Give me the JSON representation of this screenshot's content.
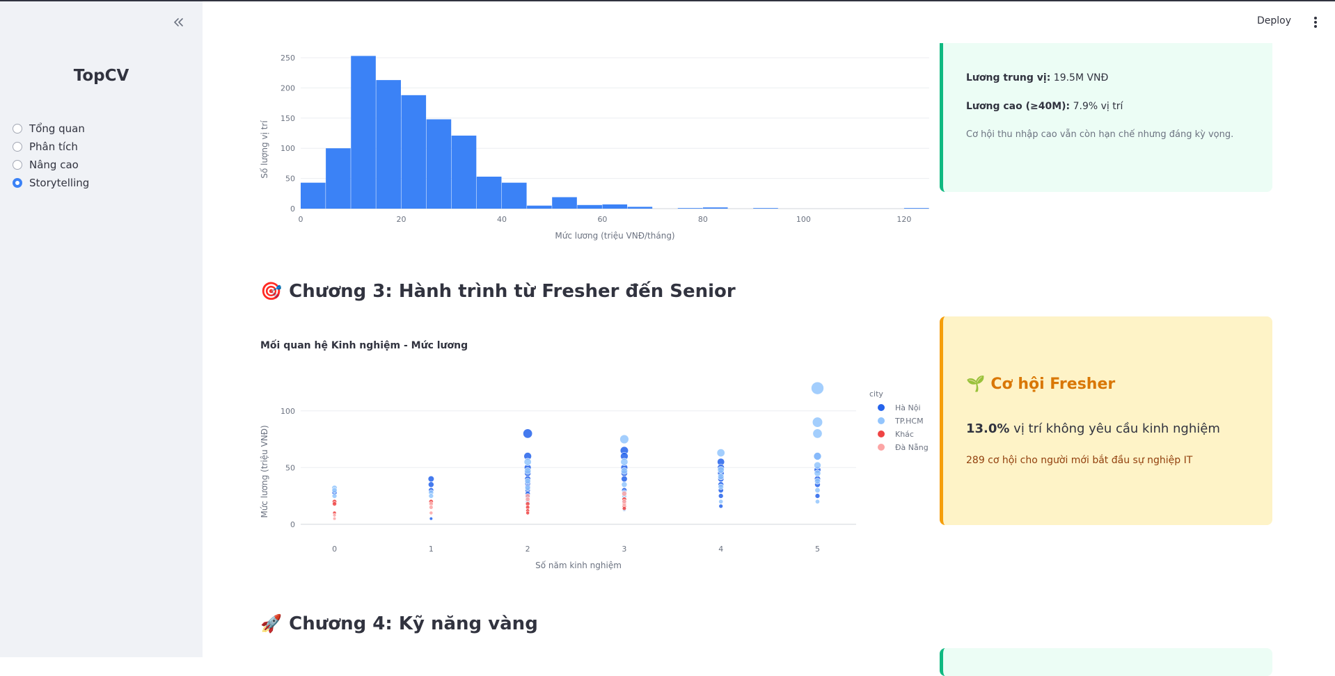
{
  "sidebar": {
    "brand": "TopCV",
    "nav": [
      {
        "label": "Tổng quan",
        "selected": false
      },
      {
        "label": "Phân tích",
        "selected": false
      },
      {
        "label": "Nâng cao",
        "selected": false
      },
      {
        "label": "Storytelling",
        "selected": true
      }
    ]
  },
  "header": {
    "deploy_label": "Deploy"
  },
  "histogram": {
    "chart_data": {
      "type": "bar",
      "xlabel": "Mức lương (triệu VNĐ/tháng)",
      "ylabel": "Số lượng vị trí",
      "xlim": [
        0,
        125
      ],
      "ylim": [
        0,
        265
      ],
      "x_ticks": [
        0,
        20,
        40,
        60,
        80,
        100,
        120
      ],
      "y_ticks": [
        0,
        50,
        100,
        150,
        200,
        250
      ],
      "bin_width": 5,
      "bins": [
        0,
        5,
        10,
        15,
        20,
        25,
        30,
        35,
        40,
        45,
        50,
        55,
        60,
        65,
        70,
        75,
        80,
        85,
        90,
        95,
        100,
        105,
        110,
        115,
        120
      ],
      "values": [
        43,
        100,
        253,
        213,
        188,
        148,
        121,
        53,
        43,
        5,
        19,
        6,
        7,
        3,
        0,
        1,
        2,
        0,
        1,
        0,
        0,
        0,
        0,
        0,
        1
      ],
      "color": "#3b82f6"
    }
  },
  "chapter3": {
    "emoji": "🎯",
    "title": "Chương 3: Hành trình từ Fresher đến Senior"
  },
  "scatter": {
    "title": "Mối quan hệ Kinh nghiệm - Mức lương",
    "chart_data": {
      "type": "scatter",
      "xlabel": "Số năm kinh nghiệm",
      "ylabel": "Mức lương (triệu VNĐ)",
      "xlim": [
        -0.35,
        5.4
      ],
      "ylim": [
        -5,
        125
      ],
      "x_ticks": [
        0,
        1,
        2,
        3,
        4,
        5
      ],
      "y_ticks": [
        0,
        50,
        100
      ],
      "legend_title": "city",
      "legend_position": "right",
      "series": [
        {
          "name": "Hà Nội",
          "color": "#2563eb",
          "points": [
            [
              0,
              28
            ],
            [
              1,
              40
            ],
            [
              1,
              35
            ],
            [
              1,
              30
            ],
            [
              2,
              80
            ],
            [
              2,
              60
            ],
            [
              2,
              50
            ],
            [
              2,
              45
            ],
            [
              2,
              40
            ],
            [
              2,
              36
            ],
            [
              2,
              33
            ],
            [
              2,
              30
            ],
            [
              2,
              27
            ],
            [
              2,
              24
            ],
            [
              3,
              65
            ],
            [
              3,
              60
            ],
            [
              3,
              50
            ],
            [
              3,
              45
            ],
            [
              3,
              40
            ],
            [
              3,
              30
            ],
            [
              3,
              20
            ],
            [
              4,
              55
            ],
            [
              4,
              50
            ],
            [
              4,
              45
            ],
            [
              4,
              40
            ],
            [
              4,
              35
            ],
            [
              4,
              30
            ],
            [
              4,
              25
            ],
            [
              4,
              16
            ],
            [
              5,
              60
            ],
            [
              5,
              48
            ],
            [
              5,
              40
            ],
            [
              5,
              35
            ],
            [
              5,
              25
            ],
            [
              1,
              5
            ]
          ]
        },
        {
          "name": "TP.HCM",
          "color": "#93c5fd",
          "points": [
            [
              0,
              32
            ],
            [
              0,
              30
            ],
            [
              0,
              25
            ],
            [
              1,
              28
            ],
            [
              1,
              25
            ],
            [
              2,
              55
            ],
            [
              2,
              47
            ],
            [
              2,
              38
            ],
            [
              2,
              32
            ],
            [
              2,
              20
            ],
            [
              3,
              75
            ],
            [
              3,
              55
            ],
            [
              3,
              47
            ],
            [
              3,
              35
            ],
            [
              3,
              28
            ],
            [
              3,
              25
            ],
            [
              3,
              13
            ],
            [
              4,
              63
            ],
            [
              4,
              48
            ],
            [
              4,
              42
            ],
            [
              4,
              33
            ],
            [
              4,
              20
            ],
            [
              5,
              120
            ],
            [
              5,
              90
            ],
            [
              5,
              80
            ],
            [
              5,
              60
            ],
            [
              5,
              52
            ],
            [
              5,
              45
            ],
            [
              5,
              38
            ],
            [
              5,
              30
            ],
            [
              5,
              20
            ]
          ]
        },
        {
          "name": "Khác",
          "color": "#ef4444",
          "points": [
            [
              0,
              20
            ],
            [
              0,
              18
            ],
            [
              0,
              10
            ],
            [
              1,
              20
            ],
            [
              2,
              18
            ],
            [
              2,
              15
            ],
            [
              2,
              12
            ],
            [
              2,
              10
            ],
            [
              3,
              22
            ],
            [
              3,
              16
            ],
            [
              3,
              14
            ]
          ]
        },
        {
          "name": "Đà Nẵng",
          "color": "#fca5a5",
          "points": [
            [
              0,
              8
            ],
            [
              0,
              5
            ],
            [
              1,
              18
            ],
            [
              1,
              15
            ],
            [
              1,
              10
            ],
            [
              2,
              25
            ],
            [
              2,
              22
            ],
            [
              3,
              27
            ],
            [
              3,
              18
            ],
            [
              3,
              20
            ]
          ]
        }
      ]
    }
  },
  "chapter4": {
    "emoji": "🚀",
    "title": "Chương 4: Kỹ năng vàng"
  },
  "salary_card": {
    "median_label": "Lương trung vị:",
    "median_value": "19.5M VNĐ",
    "high_label": "Lương cao (≥40M):",
    "high_value": "7.9% vị trí",
    "note": "Cơ hội thu nhập cao vẫn còn hạn chế nhưng đáng kỳ vọng."
  },
  "fresher_card": {
    "emoji": "🌱",
    "title": "Cơ hội Fresher",
    "stat_value": "13.0%",
    "stat_text": " vị trí không yêu cầu kinh nghiệm",
    "note": "289 cơ hội cho người mới bắt đầu sự nghiệp IT"
  },
  "colors": {
    "accent": "#3b82f6",
    "green_card_bg": "#ecfdf5",
    "green_card_border": "#10b981",
    "yellow_card_bg": "#fef3c7",
    "yellow_card_border": "#f59e0b",
    "fresher_title": "#d97706"
  }
}
